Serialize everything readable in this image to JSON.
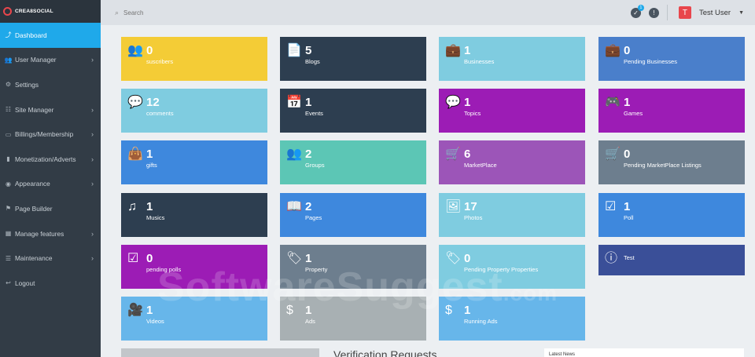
{
  "brand": {
    "name": "CREA8SOCIAL"
  },
  "sidebar": {
    "items": [
      {
        "label": "Dashboard",
        "icon": "trend",
        "active": true,
        "has_chevron": false
      },
      {
        "label": "User Manager",
        "icon": "users",
        "has_chevron": true
      },
      {
        "label": "Settings",
        "icon": "gear",
        "has_chevron": false
      },
      {
        "label": "Site Manager",
        "icon": "sliders",
        "has_chevron": true
      },
      {
        "label": "Billings/Membership",
        "icon": "card",
        "has_chevron": true
      },
      {
        "label": "Monetization/Adverts",
        "icon": "chart",
        "has_chevron": true
      },
      {
        "label": "Appearance",
        "icon": "palette",
        "has_chevron": true
      },
      {
        "label": "Page Builder",
        "icon": "flag",
        "has_chevron": false
      },
      {
        "label": "Manage features",
        "icon": "grid",
        "has_chevron": true
      },
      {
        "label": "Maintenance",
        "icon": "list",
        "has_chevron": true
      },
      {
        "label": "Logout",
        "icon": "reply",
        "has_chevron": false
      }
    ]
  },
  "search": {
    "placeholder": "Search"
  },
  "topbar": {
    "badge_count": "1",
    "user_initial": "T",
    "user_name": "Test User"
  },
  "tiles": [
    {
      "count": "0",
      "label": "suscribers",
      "color": "#f4cc36",
      "icon": "👥"
    },
    {
      "count": "5",
      "label": "Blogs",
      "color": "#2d3e50",
      "icon": "📄"
    },
    {
      "count": "1",
      "label": "Businesses",
      "color": "#7fcce0",
      "icon": "💼"
    },
    {
      "count": "0",
      "label": "Pending Businesses",
      "color": "#4a7fcb",
      "icon": "💼"
    },
    {
      "count": "12",
      "label": "comments",
      "color": "#7fcce0",
      "icon": "💬"
    },
    {
      "count": "1",
      "label": "Events",
      "color": "#2d3e50",
      "icon": "📅"
    },
    {
      "count": "1",
      "label": "Topics",
      "color": "#9c1cb5",
      "icon": "💬"
    },
    {
      "count": "1",
      "label": "Games",
      "color": "#9c1cb5",
      "icon": "🎮"
    },
    {
      "count": "1",
      "label": "gifts",
      "color": "#3e88dd",
      "icon": "👜"
    },
    {
      "count": "2",
      "label": "Groups",
      "color": "#5cc6b5",
      "icon": "👥"
    },
    {
      "count": "6",
      "label": "MarketPlace",
      "color": "#9c55b8",
      "icon": "🛒"
    },
    {
      "count": "0",
      "label": "Pending MarketPlace Listings",
      "color": "#6d7e8e",
      "icon": "🛒"
    },
    {
      "count": "1",
      "label": "Musics",
      "color": "#2d3e50",
      "icon": "♫"
    },
    {
      "count": "2",
      "label": "Pages",
      "color": "#3e88dd",
      "icon": "📖"
    },
    {
      "count": "17",
      "label": "Photos",
      "color": "#7fcce0",
      "icon": "🖼"
    },
    {
      "count": "1",
      "label": "Poll",
      "color": "#3e88dd",
      "icon": "☑"
    },
    {
      "count": "0",
      "label": "pending polls",
      "color": "#9c1cb5",
      "icon": "☑"
    },
    {
      "count": "1",
      "label": "Property",
      "color": "#6d7e8e",
      "icon": "🏷"
    },
    {
      "count": "0",
      "label": "Pending Property Properties",
      "color": "#7fcce0",
      "icon": "🏷"
    },
    {
      "count": "",
      "label": "Test",
      "color": "#3a4f98",
      "icon": "ⓘ"
    },
    {
      "count": "1",
      "label": "Videos",
      "color": "#67b6ea",
      "icon": "🎥"
    },
    {
      "count": "1",
      "label": "Ads",
      "color": "#a8b0b3",
      "icon": "$"
    },
    {
      "count": "1",
      "label": "Running Ads",
      "color": "#67b6ea",
      "icon": "$"
    }
  ],
  "sections": {
    "verification_title": "Verification Requests",
    "latest_news": "Latest News"
  },
  "watermark": {
    "text": "SoftwareSuggest",
    "suffix": ".com"
  }
}
